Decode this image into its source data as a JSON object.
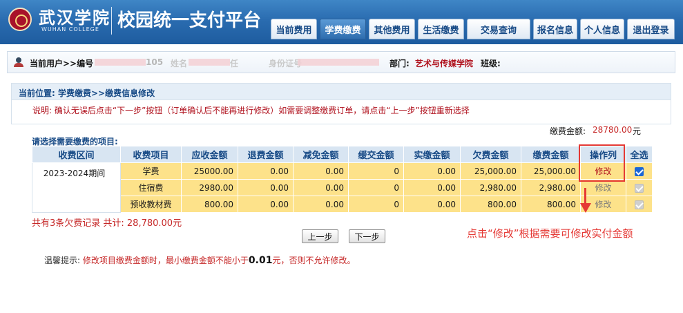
{
  "header": {
    "logo_cn": "武汉学院",
    "logo_en": "WUHAN COLLEGE",
    "system_title": "校园统一支付平台",
    "nav": [
      "当前费用",
      "学费缴费",
      "其他费用",
      "生活缴费",
      "交易查询",
      "报名信息",
      "个人信息",
      "退出登录"
    ],
    "active_nav": "学费缴费"
  },
  "userbar": {
    "current_user": "当前用户>>编号",
    "id_fragment": "105",
    "name_label": "姓名",
    "mask1": "任",
    "mask2": "身份证号",
    "dept_label": "部门:",
    "dept_value": "艺术与传媒学院",
    "class_label": "班级:"
  },
  "location": "当前位置: 学费缴费>>缴费信息修改",
  "note": "说明: 确认无误后点击“下一步”按钮（订单确认后不能再进行修改）如需要调整缴费订单，请点击“上一步”按钮重新选择",
  "total": {
    "label": "缴费金额:",
    "value": "28780.00",
    "unit": "元"
  },
  "pick_label": "请选择需要缴费的项目:",
  "table": {
    "headers": [
      "收费区间",
      "收费项目",
      "应收金额",
      "退费金额",
      "减免金额",
      "缓交金额",
      "实缴金额",
      "欠费金额",
      "缴费金额",
      "操作列",
      "全选"
    ],
    "period": "2023-2024期间",
    "rows": [
      {
        "item": "学费",
        "due": "25000.00",
        "refund": "0.00",
        "waive": "0.00",
        "defer": "0",
        "paid": "0.00",
        "owed": "25,000.00",
        "pay": "25,000.00",
        "op": "修改",
        "checked": true
      },
      {
        "item": "住宿费",
        "due": "2980.00",
        "refund": "0.00",
        "waive": "0.00",
        "defer": "0",
        "paid": "0.00",
        "owed": "2,980.00",
        "pay": "2,980.00",
        "op": "修改",
        "checked": true
      },
      {
        "item": "预收教材费",
        "due": "800.00",
        "refund": "0.00",
        "waive": "0.00",
        "defer": "0",
        "paid": "0.00",
        "owed": "800.00",
        "pay": "800.00",
        "op": "修改",
        "checked": true
      }
    ]
  },
  "summary": "共有3条欠费记录  共计: 28,780.00元",
  "buttons": {
    "prev": "上一步",
    "next": "下一步"
  },
  "callout": "点击“修改”根据需要可修改实付金额",
  "tip": {
    "prefix": "温馨提示:",
    "text1": "修改项目缴费金额时，最小缴费金额不能小于",
    "amount": "0.01",
    "text2": "元，否则不允许修改。"
  },
  "colors": {
    "header_blue": "#2a6cb0",
    "accent_red": "#c62828",
    "row_yellow": "#fde28a",
    "checkbox_blue": "#1a66d6"
  }
}
